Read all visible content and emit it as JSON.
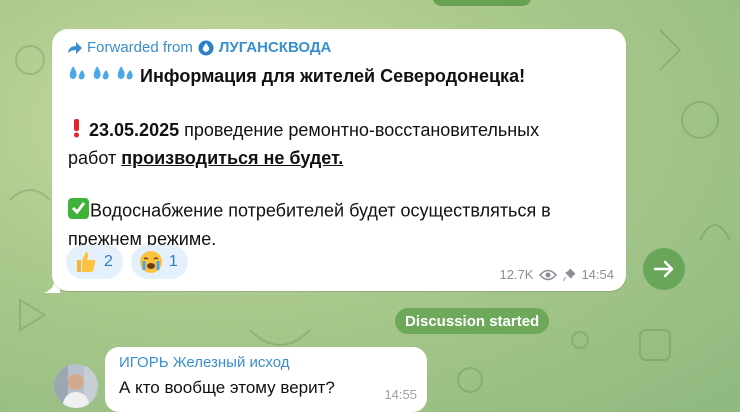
{
  "post": {
    "forwarded_prefix": "Forwarded from",
    "channel": "ЛУГАНСКВОДА",
    "title": "Информация для жителей Северодонецка!",
    "date": "23.05.2025",
    "text_1": " проведение ремонтно-восстановительных",
    "text_2": "работ ",
    "underlined": "производиться не будет.",
    "text_3": "Водоснабжение потребителей будет осуществляться в",
    "text_4": "прежнем режиме.",
    "reactions": [
      {
        "icon": "thumbs-up-icon",
        "count": "2"
      },
      {
        "icon": "crying-face-icon",
        "count": "1"
      }
    ],
    "views": "12.7K",
    "time": "14:54"
  },
  "divider": {
    "label": "Discussion started"
  },
  "comment": {
    "author": "ИГОРЬ Железный исход",
    "text": "А кто вообще этому верит?",
    "time": "14:55"
  }
}
